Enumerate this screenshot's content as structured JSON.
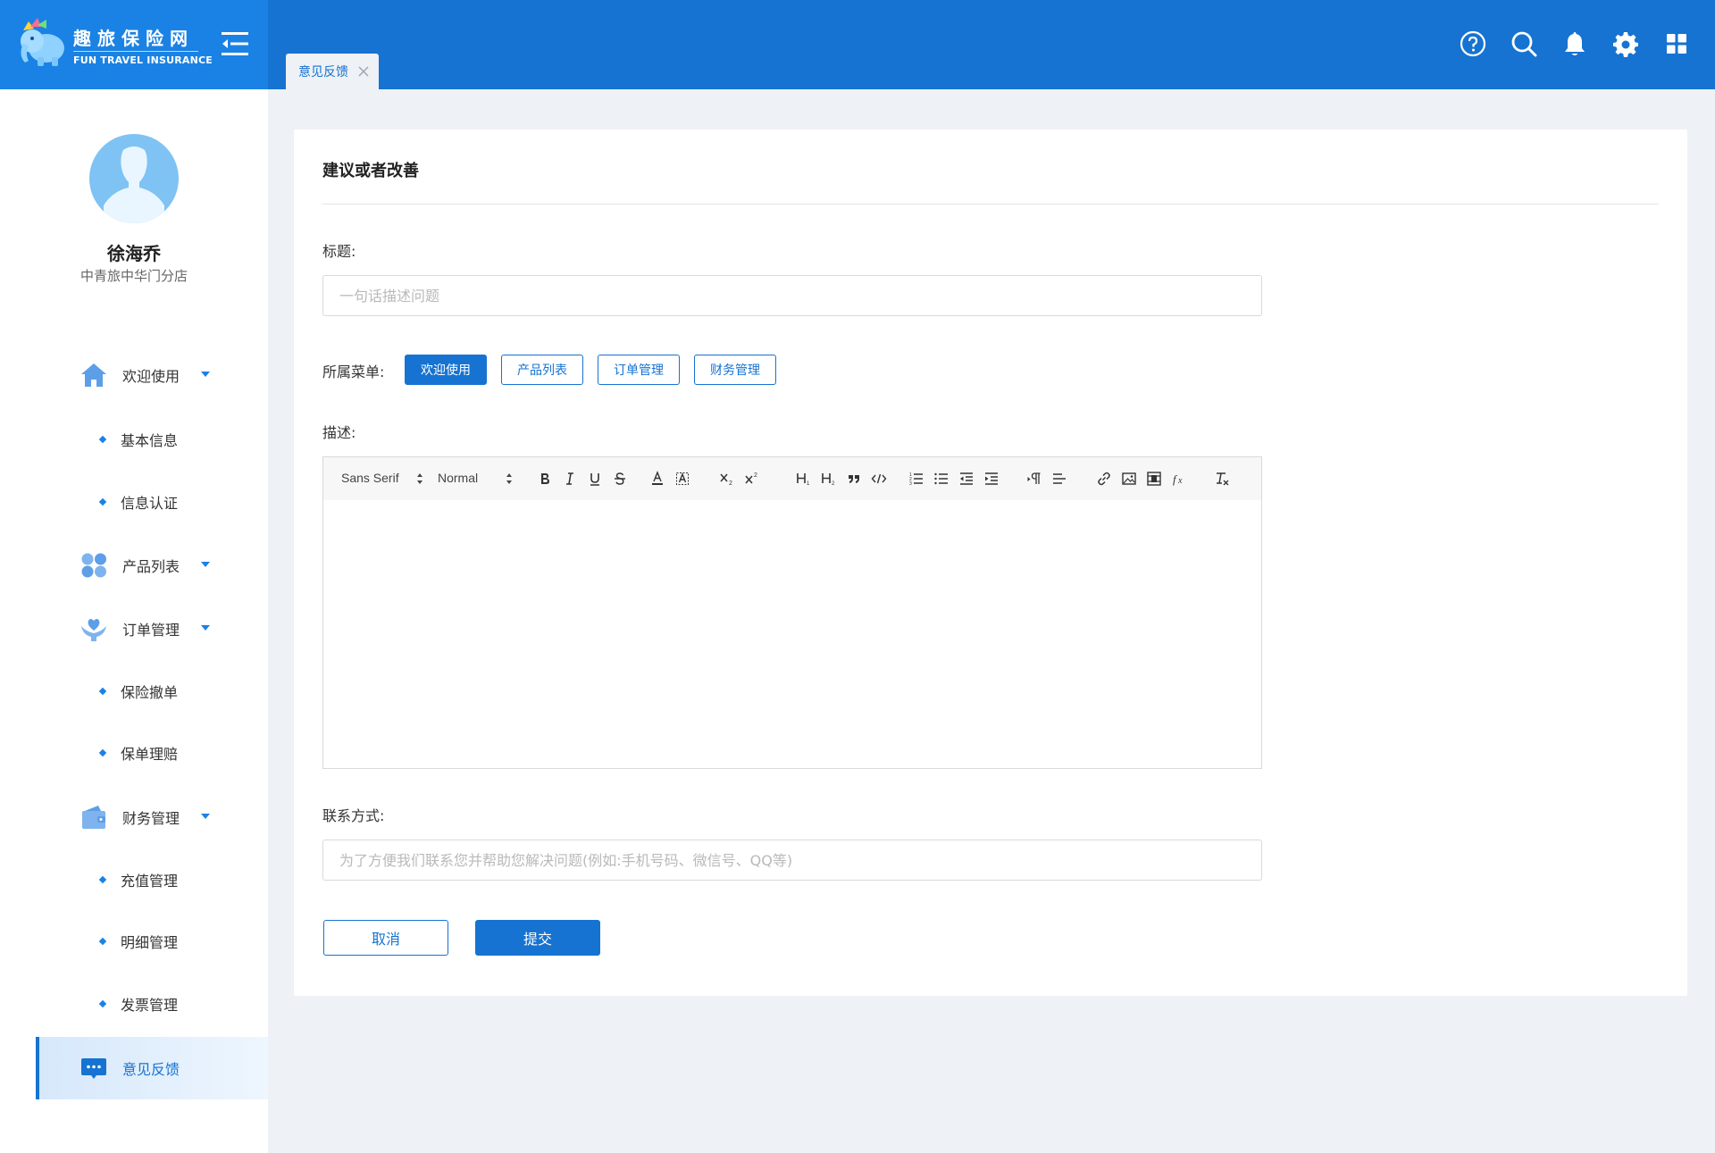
{
  "brand": {
    "name_cn": "趣旅保险网",
    "name_en": "FUN TRAVEL INSURANCE"
  },
  "tabs": [
    {
      "label": "意见反馈"
    }
  ],
  "header_icons": [
    "help-icon",
    "search-icon",
    "bell-icon",
    "gear-icon",
    "apps-grid-icon"
  ],
  "user": {
    "name": "徐海乔",
    "org": "中青旅中华门分店"
  },
  "sidebar": {
    "items": [
      {
        "label": "欢迎使用",
        "icon": "home-icon",
        "level": 1
      },
      {
        "label": "基本信息",
        "level": 2
      },
      {
        "label": "信息认证",
        "level": 2
      },
      {
        "label": "产品列表",
        "icon": "grid-icon",
        "level": 1
      },
      {
        "label": "订单管理",
        "icon": "heart-hand-icon",
        "level": 1
      },
      {
        "label": "保险撤单",
        "level": 2
      },
      {
        "label": "保单理赔",
        "level": 2
      },
      {
        "label": "财务管理",
        "icon": "wallet-icon",
        "level": 1
      },
      {
        "label": "充值管理",
        "level": 2
      },
      {
        "label": "明细管理",
        "level": 2
      },
      {
        "label": "发票管理",
        "level": 2
      },
      {
        "label": "意见反馈",
        "icon": "chat-icon",
        "level": 1,
        "active": true
      }
    ]
  },
  "form": {
    "heading": "建议或者改善",
    "title_label": "标题:",
    "title_placeholder": "一句话描述问题",
    "menu_label": "所属菜单:",
    "menu_options": [
      "欢迎使用",
      "产品列表",
      "订单管理",
      "财务管理"
    ],
    "menu_selected": "欢迎使用",
    "desc_label": "描述:",
    "editor": {
      "font": "Sans Serif",
      "size": "Normal"
    },
    "contact_label": "联系方式:",
    "contact_placeholder": "为了方便我们联系您并帮助您解决问题(例如:手机号码、微信号、QQ等)",
    "cancel_label": "取消",
    "submit_label": "提交"
  },
  "colors": {
    "primary": "#1673d1",
    "logo_bg": "#1a82e4",
    "page_bg": "#eef1f5"
  }
}
